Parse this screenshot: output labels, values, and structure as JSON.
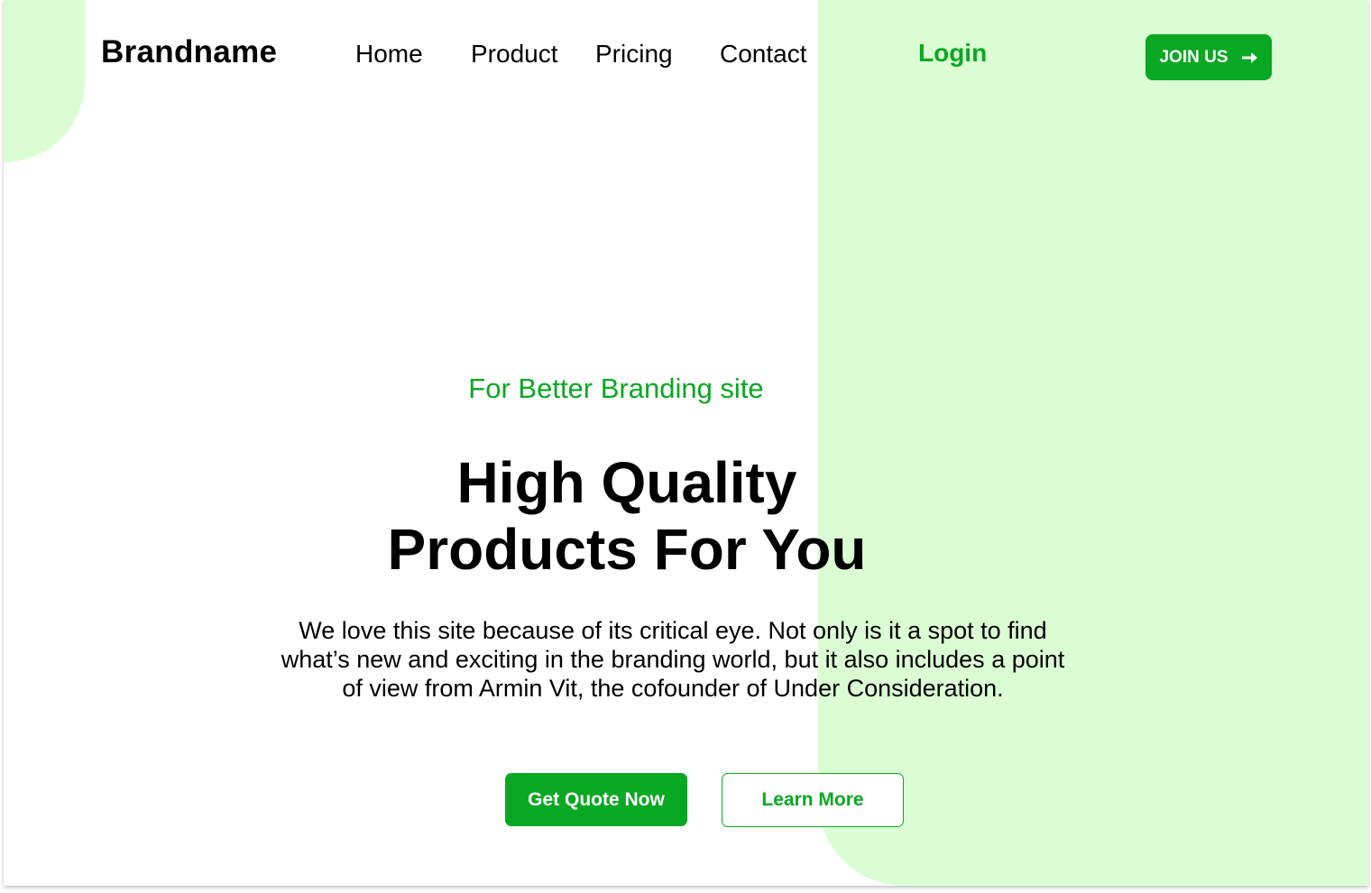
{
  "colors": {
    "accent": "#09A822",
    "panel": "#DBFDD3",
    "text": "#000000",
    "white": "#FFFFFF"
  },
  "header": {
    "brand": "Brandname",
    "nav": [
      "Home",
      "Product",
      "Pricing",
      "Contact"
    ],
    "login": "Login",
    "join": {
      "label": "JOIN US",
      "icon": "arrow-right-icon"
    }
  },
  "hero": {
    "tagline": "For Better Branding site",
    "headline": [
      "High Quality",
      "Products For You"
    ],
    "description": [
      "We love this site because of its critical eye. Not only is it a spot to find",
      "what’s new and exciting in the branding world, but it also includes a point",
      "of view from Armin Vit, the cofounder of Under Consideration."
    ],
    "primary_cta": "Get Quote Now",
    "secondary_cta": "Learn More"
  }
}
